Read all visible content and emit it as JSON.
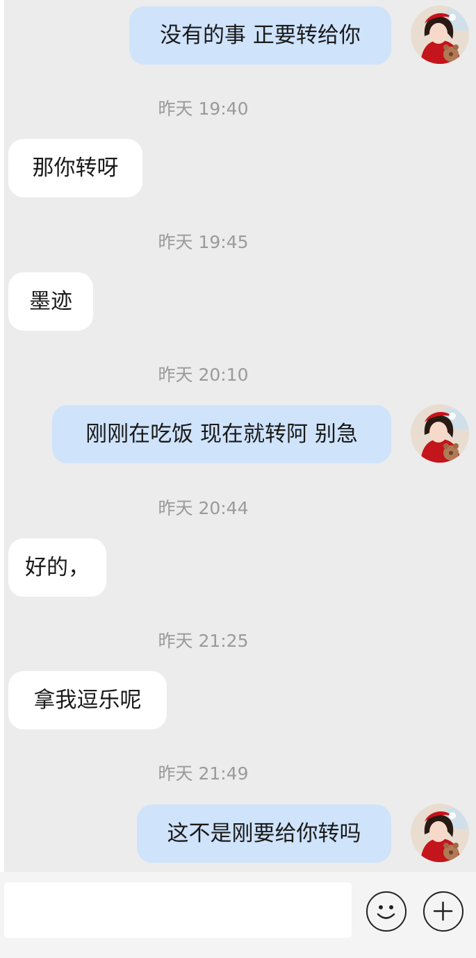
{
  "messages": [
    {
      "type": "mine",
      "text": "没有的事 正要转给你"
    },
    {
      "type": "time",
      "text": "昨天 19:40"
    },
    {
      "type": "theirs",
      "text": "那你转呀"
    },
    {
      "type": "time",
      "text": "昨天 19:45"
    },
    {
      "type": "theirs",
      "text": "墨迹"
    },
    {
      "type": "time",
      "text": "昨天 20:10"
    },
    {
      "type": "mine",
      "text": "刚刚在吃饭 现在就转阿 别急"
    },
    {
      "type": "time",
      "text": "昨天 20:44"
    },
    {
      "type": "theirs",
      "text": "好的，"
    },
    {
      "type": "time",
      "text": "昨天 21:25"
    },
    {
      "type": "theirs",
      "text": "拿我逗乐呢"
    },
    {
      "type": "time",
      "text": "昨天 21:49"
    },
    {
      "type": "mine",
      "text": "这不是刚要给你转吗"
    }
  ],
  "input": {
    "placeholder": ""
  },
  "icons": {
    "emoji": "smiley-face-icon",
    "more": "plus-icon"
  },
  "colors": {
    "mine_bubble": "#cfe3fb",
    "theirs_bubble": "#ffffff",
    "background": "#ececec",
    "time_text": "#9a9a9a"
  }
}
